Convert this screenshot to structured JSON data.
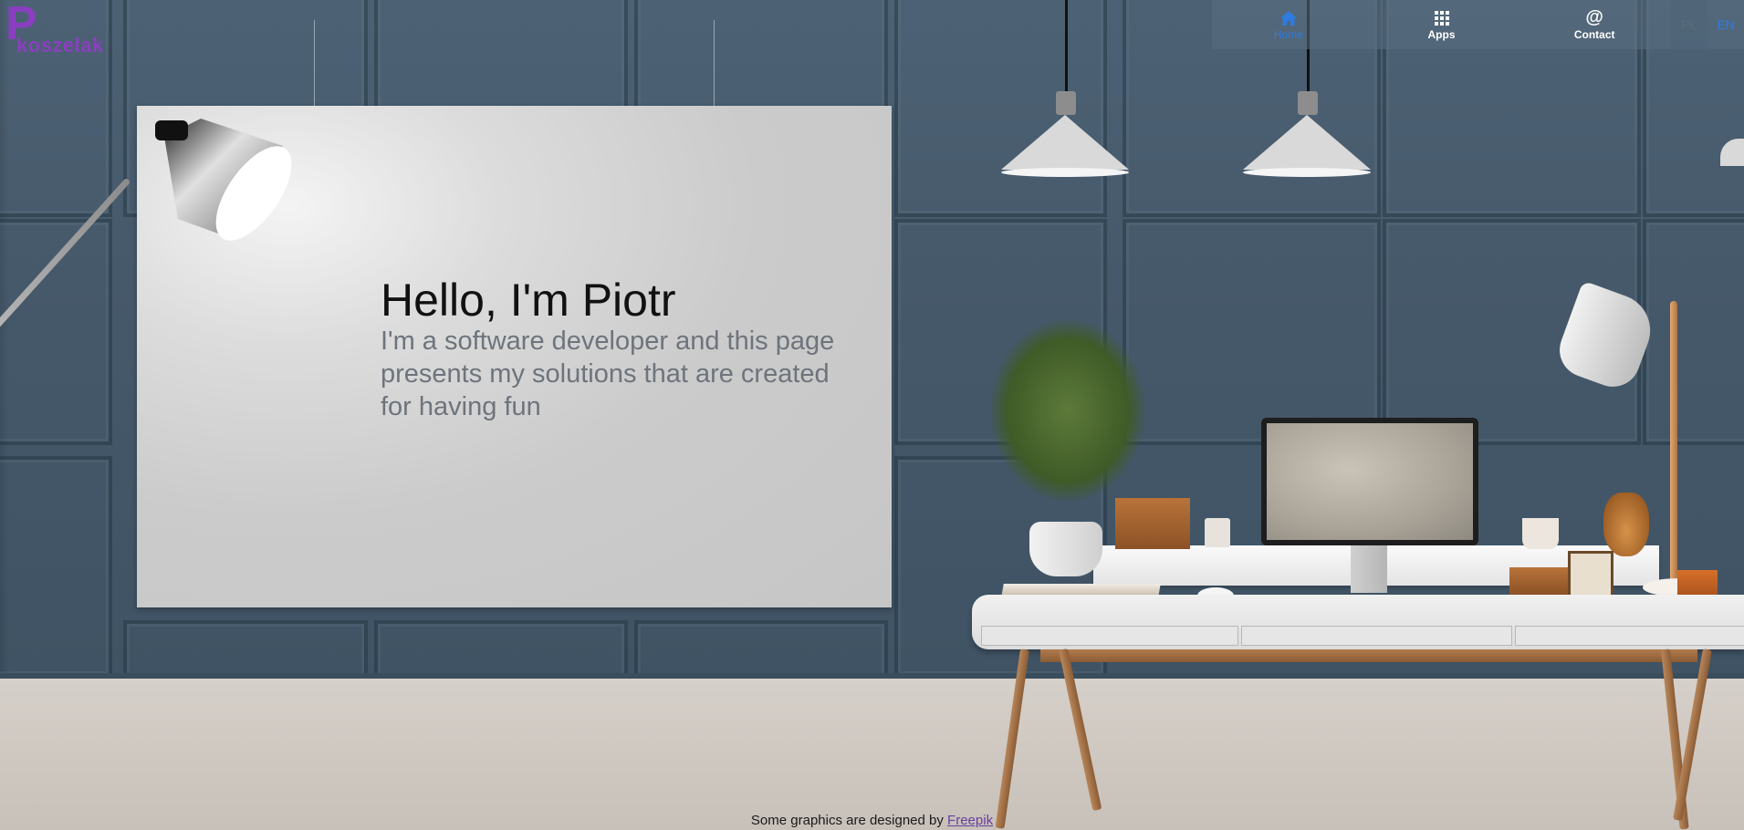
{
  "logo": {
    "first_letter": "P",
    "rest": "koszelak"
  },
  "nav": {
    "items": [
      {
        "label": "Home",
        "icon": "home-icon",
        "active": true
      },
      {
        "label": "Apps",
        "icon": "grid-icon",
        "active": false
      },
      {
        "label": "Contact",
        "icon": "at-icon",
        "active": false
      }
    ],
    "languages": [
      {
        "label": "PL",
        "active": false
      },
      {
        "label": "EN",
        "active": true
      }
    ]
  },
  "hero": {
    "title": "Hello, I'm Piotr",
    "subtitle": "I'm a software developer and this page presents my solutions that are created for having fun"
  },
  "footer": {
    "text": "Some graphics are designed by ",
    "link_label": "Freepik"
  },
  "colors": {
    "accent": "#2f7be0",
    "brand": "#8a3fc0",
    "wall": "#46596a"
  }
}
